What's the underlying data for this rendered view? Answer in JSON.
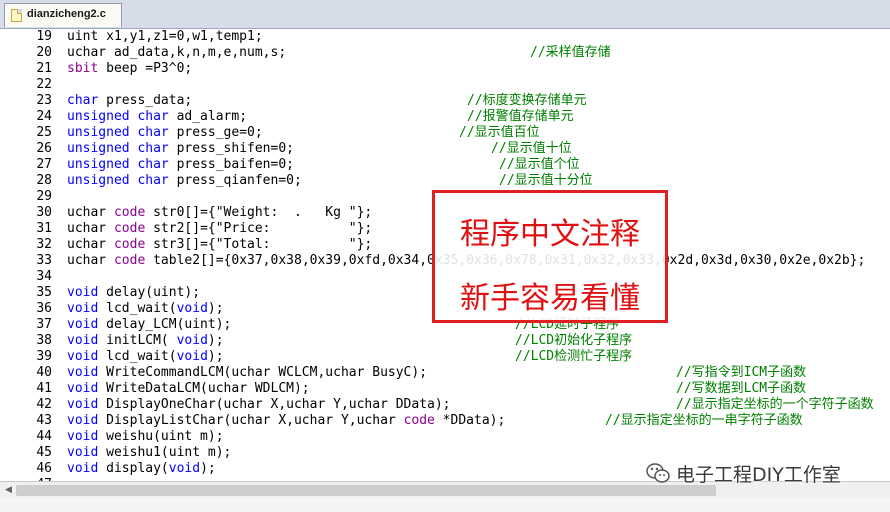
{
  "tab": {
    "filename": "dianzicheng2.c"
  },
  "lines": [
    {
      "n": "19",
      "code": [
        {
          "t": "uint x1,y1,z1=0,w1,temp1;"
        }
      ]
    },
    {
      "n": "20",
      "code": [
        {
          "t": "uchar ad_data,k,n,m,e,num,s;"
        }
      ],
      "comment": "//采样值存储",
      "ccol": 530
    },
    {
      "n": "21",
      "code": [
        {
          "t": "sbit",
          "k": "kw2"
        },
        {
          "t": " beep =P3^0;"
        }
      ]
    },
    {
      "n": "22",
      "code": []
    },
    {
      "n": "23",
      "code": [
        {
          "t": "char",
          "k": "kw"
        },
        {
          "t": " press_data;"
        }
      ],
      "comment": "//标度变换存储单元",
      "ccol": 467
    },
    {
      "n": "24",
      "code": [
        {
          "t": "unsigned char",
          "k": "kw"
        },
        {
          "t": " ad_alarm;"
        }
      ],
      "comment": "//报警值存储单元",
      "ccol": 467
    },
    {
      "n": "25",
      "code": [
        {
          "t": "unsigned char",
          "k": "kw"
        },
        {
          "t": " press_ge=0;"
        }
      ],
      "comment": "//显示值百位",
      "ccol": 459
    },
    {
      "n": "26",
      "code": [
        {
          "t": "unsigned char",
          "k": "kw"
        },
        {
          "t": " press_shifen=0;"
        }
      ],
      "comment": "//显示值十位",
      "ccol": 491
    },
    {
      "n": "27",
      "code": [
        {
          "t": "unsigned char",
          "k": "kw"
        },
        {
          "t": " press_baifen=0;"
        }
      ],
      "comment": "//显示值个位",
      "ccol": 499
    },
    {
      "n": "28",
      "code": [
        {
          "t": "unsigned char",
          "k": "kw"
        },
        {
          "t": " press_qianfen=0;"
        }
      ],
      "comment": "//显示值十分位",
      "ccol": 499
    },
    {
      "n": "29",
      "code": []
    },
    {
      "n": "30",
      "code": [
        {
          "t": "uchar "
        },
        {
          "t": "code",
          "k": "kw2"
        },
        {
          "t": " str0[]={\"Weight:  .   Kg \"};"
        }
      ]
    },
    {
      "n": "31",
      "code": [
        {
          "t": "uchar "
        },
        {
          "t": "code",
          "k": "kw2"
        },
        {
          "t": " str2[]={\"Price:          \"};"
        }
      ]
    },
    {
      "n": "32",
      "code": [
        {
          "t": "uchar "
        },
        {
          "t": "code",
          "k": "kw2"
        },
        {
          "t": " str3[]={\"Total:          \"};"
        }
      ]
    },
    {
      "n": "33",
      "code": [
        {
          "t": "uchar "
        },
        {
          "t": "code",
          "k": "kw2"
        },
        {
          "t": " table2[]={0x37,0x38,0x39,0xfd,0x34,0x35,0x36,0x78,0x31,0x32,0x33,0x2d,0x3d,0x30,0x2e,0x2b};"
        }
      ]
    },
    {
      "n": "34",
      "code": []
    },
    {
      "n": "35",
      "code": [
        {
          "t": "void",
          "k": "kw"
        },
        {
          "t": " delay(uint);"
        }
      ]
    },
    {
      "n": "36",
      "code": [
        {
          "t": "void",
          "k": "kw"
        },
        {
          "t": " lcd_wait("
        },
        {
          "t": "void",
          "k": "kw"
        },
        {
          "t": ");"
        }
      ]
    },
    {
      "n": "37",
      "code": [
        {
          "t": "void",
          "k": "kw"
        },
        {
          "t": " delay_LCM(uint);"
        }
      ],
      "comment": "//LCD延时子程序",
      "ccol": 515
    },
    {
      "n": "38",
      "code": [
        {
          "t": "void",
          "k": "kw"
        },
        {
          "t": " initLCM( "
        },
        {
          "t": "void",
          "k": "kw"
        },
        {
          "t": ");"
        }
      ],
      "comment": "//LCD初始化子程序",
      "ccol": 515
    },
    {
      "n": "39",
      "code": [
        {
          "t": "void",
          "k": "kw"
        },
        {
          "t": " lcd_wait("
        },
        {
          "t": "void",
          "k": "kw"
        },
        {
          "t": ");"
        }
      ],
      "comment": "//LCD检测忙子程序",
      "ccol": 515
    },
    {
      "n": "40",
      "code": [
        {
          "t": "void",
          "k": "kw"
        },
        {
          "t": " WriteCommandLCM(uchar WCLCM,uchar BusyC);"
        }
      ],
      "comment": "//写指令到ICM子函数",
      "ccol": 676
    },
    {
      "n": "41",
      "code": [
        {
          "t": "void",
          "k": "kw"
        },
        {
          "t": " WriteDataLCM(uchar WDLCM);"
        }
      ],
      "comment": "//写数据到LCM子函数",
      "ccol": 676
    },
    {
      "n": "42",
      "code": [
        {
          "t": "void",
          "k": "kw"
        },
        {
          "t": " DisplayOneChar(uchar X,uchar Y,uchar DData);"
        }
      ],
      "comment": "//显示指定坐标的一个字符子函数",
      "ccol": 676
    },
    {
      "n": "43",
      "code": [
        {
          "t": "void",
          "k": "kw"
        },
        {
          "t": " DisplayListChar(uchar X,uchar Y,uchar "
        },
        {
          "t": "code",
          "k": "kw2"
        },
        {
          "t": " *DData);"
        }
      ],
      "comment": "//显示指定坐标的一串字符子函数",
      "ccol": 605
    },
    {
      "n": "44",
      "code": [
        {
          "t": "void",
          "k": "kw"
        },
        {
          "t": " weishu(uint m);"
        }
      ]
    },
    {
      "n": "45",
      "code": [
        {
          "t": "void",
          "k": "kw"
        },
        {
          "t": " weishu1(uint m);"
        }
      ]
    },
    {
      "n": "46",
      "code": [
        {
          "t": "void",
          "k": "kw"
        },
        {
          "t": " display("
        },
        {
          "t": "void",
          "k": "kw"
        },
        {
          "t": ");"
        }
      ]
    },
    {
      "n": "47",
      "code": []
    }
  ],
  "overlay": {
    "line1": "程序中文注释",
    "line2": "新手容易看懂"
  },
  "watermark": {
    "text": "电子工程DIY工作室"
  },
  "colors": {
    "keyword": "#0000ff",
    "keyword2": "#8b008b",
    "comment": "#008000",
    "overlay": "#e02020"
  },
  "icons": {
    "file": "c-file-icon",
    "watermark": "wechat-icon"
  }
}
